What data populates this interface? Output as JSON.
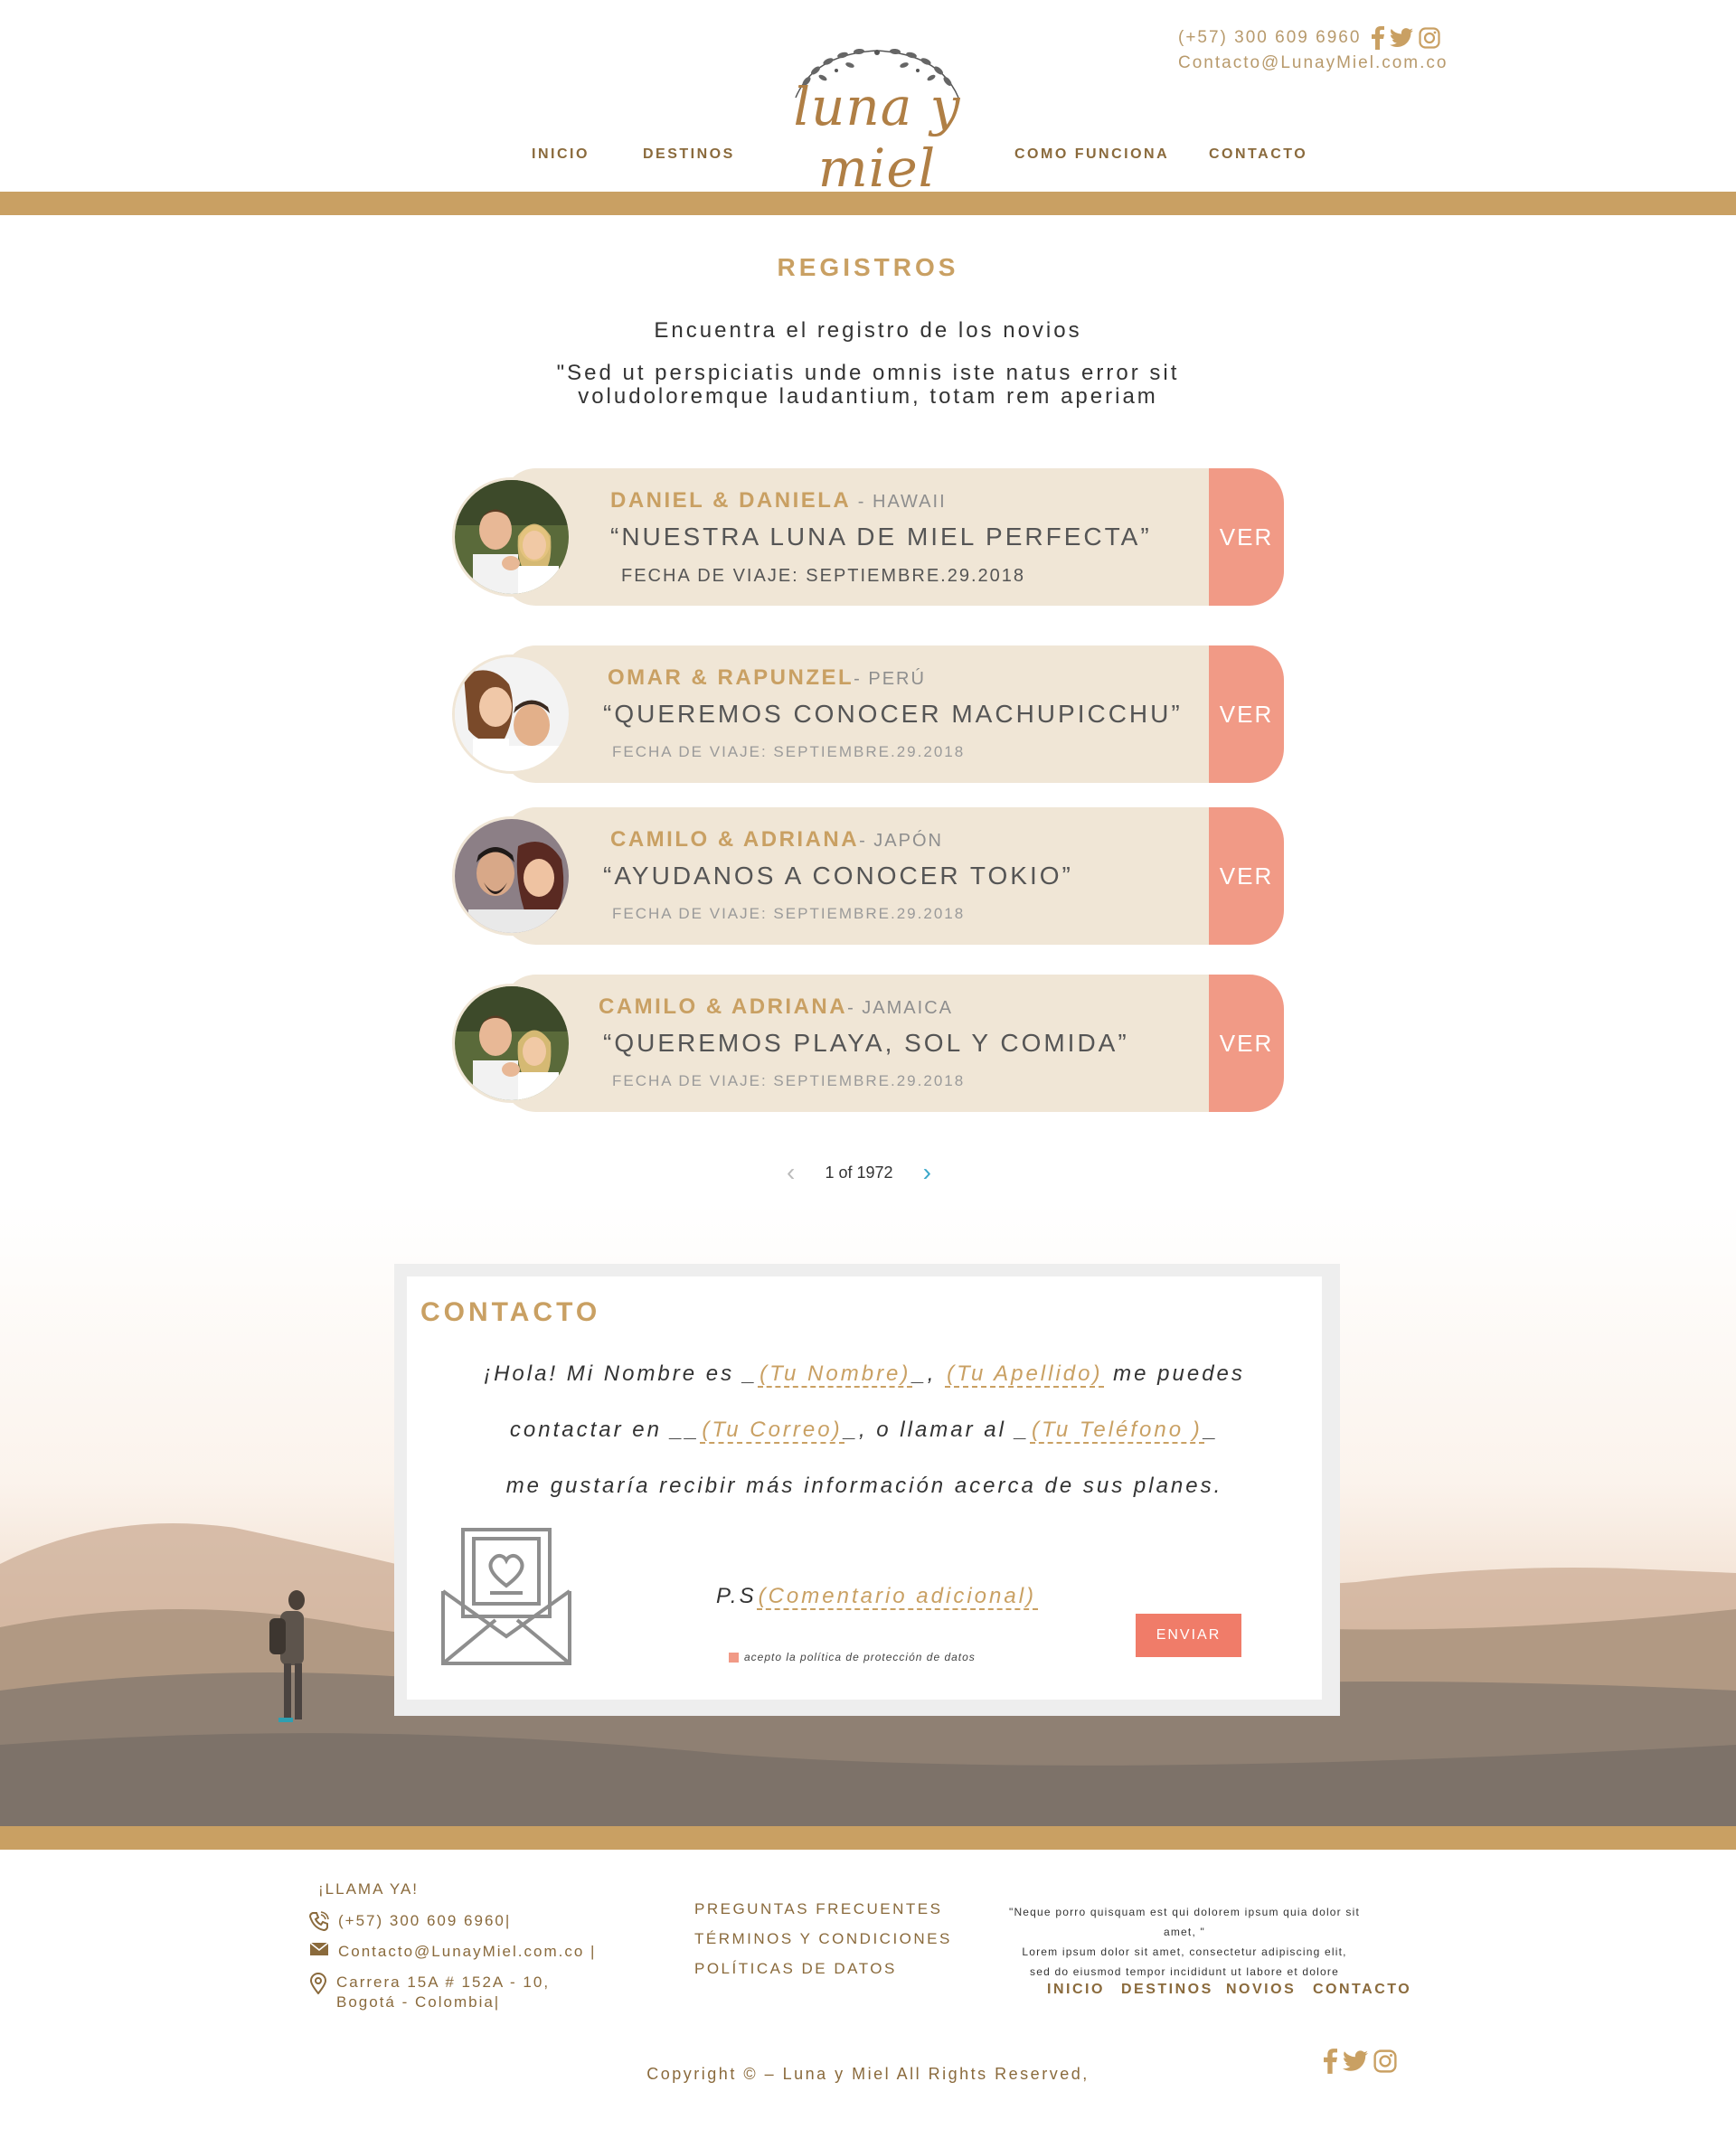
{
  "colors": {
    "gold": "#c9a063",
    "brown": "#8a6a3c",
    "card_bg": "#f0e6d6",
    "ver_button": "#f19a86",
    "send_button": "#f07c69"
  },
  "header": {
    "phone": "(+57) 300 609 6960",
    "email": "Contacto@LunayMiel.com.co",
    "logo_text": "luna y miel",
    "social_icons": [
      "facebook-icon",
      "twitter-icon",
      "instagram-icon"
    ],
    "nav": {
      "inicio": "INICIO",
      "destinos": "DESTINOS",
      "como_funciona": "COMO FUNCIONA",
      "contacto": "CONTACTO"
    }
  },
  "registros": {
    "title": "REGISTROS",
    "subtitle": "Encuentra el registro de los novios",
    "quote_line1": "\"Sed ut perspiciatis unde omnis iste natus error sit",
    "quote_line2": "voludoloremque laudantium, totam rem aperiam",
    "cards": [
      {
        "names": "DANIEL & DANIELA",
        "destination": " - HAWAII",
        "title": "“NUESTRA LUNA DE MIEL PERFECTA”",
        "date": "FECHA DE VIAJE: SEPTIEMBRE.29.2018",
        "button": "VER"
      },
      {
        "names": "OMAR & RAPUNZEL",
        "destination": "- PERÚ",
        "title": "“QUEREMOS CONOCER MACHUPICCHU”",
        "date": "FECHA DE VIAJE: SEPTIEMBRE.29.2018",
        "button": "VER"
      },
      {
        "names": "CAMILO & ADRIANA",
        "destination": "- JAPÓN",
        "title": "“AYUDANOS A CONOCER TOKIO”",
        "date": "FECHA DE VIAJE: SEPTIEMBRE.29.2018",
        "button": "VER"
      },
      {
        "names": "CAMILO & ADRIANA",
        "destination": "- JAMAICA",
        "title": "“QUEREMOS PLAYA, SOL Y COMIDA”",
        "date": "FECHA DE VIAJE: SEPTIEMBRE.29.2018",
        "button": "VER"
      }
    ],
    "pager": {
      "text": "1 of 1972",
      "prev": "‹",
      "next": "›"
    }
  },
  "contacto": {
    "title": "CONTACTO",
    "line1_a": "¡Hola! Mi Nombre es _",
    "line1_field1": "(Tu Nombre)",
    "line1_b": "_, ",
    "line1_field2": "(Tu Apellido)",
    "line1_c": " me puedes",
    "line2_a": "contactar en __",
    "line2_field1": "(Tu Correo)",
    "line2_b": "_, o llamar al _",
    "line2_field2": "(Tu Teléfono )",
    "line2_c": "_",
    "line3": "me gustaría recibir más información acerca de sus planes.",
    "ps_label": "P.S",
    "ps_field": "(Comentario adicional)",
    "privacy": "acepto la política de protección de datos",
    "send": "ENVIAR"
  },
  "footer": {
    "call_label": "¡LLAMA YA!",
    "phone": "(+57) 300 609 6960|",
    "email": "Contacto@LunayMiel.com.co |",
    "address_line1": "Carrera 15A # 152A - 10,",
    "address_line2": "Bogotá - Colombia|",
    "links": [
      "PREGUNTAS FRECUENTES",
      "TÉRMINOS Y CONDICIONES",
      "POLÍTICAS DE DATOS"
    ],
    "quote_line1": "\"Neque porro quisquam est qui dolorem ipsum quia dolor sit amet, \"",
    "quote_line2": "Lorem ipsum dolor sit amet, consectetur adipiscing elit,",
    "quote_line3": "sed do eiusmod tempor incididunt ut labore et dolore",
    "nav": {
      "inicio": "INICIO",
      "destinos": "DESTINOS",
      "novios": "NOVIOS",
      "contacto": "CONTACTO"
    },
    "copyright": "Copyright © – Luna y Miel  All Rights Reserved,"
  }
}
